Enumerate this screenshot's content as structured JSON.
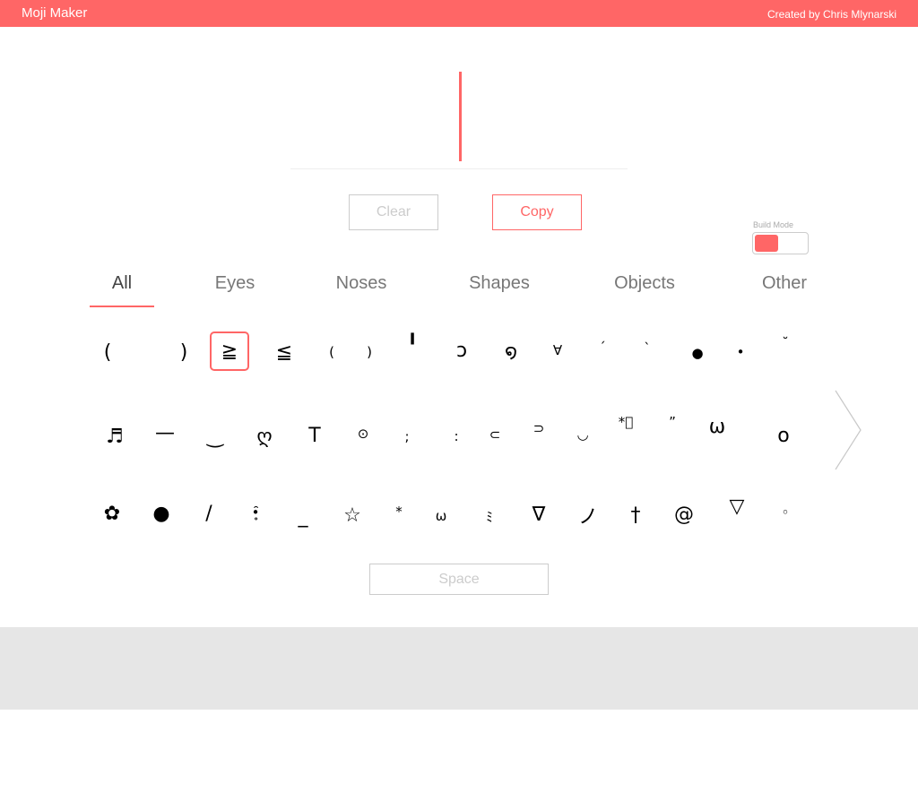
{
  "header": {
    "app_title": "Moji Maker",
    "credit": "Created by Chris Mlynarski"
  },
  "output": {
    "value": ""
  },
  "actions": {
    "clear_label": "Clear",
    "copy_label": "Copy"
  },
  "build_mode": {
    "label": "Build Mode",
    "enabled": false
  },
  "tabs": [
    {
      "label": "All",
      "active": true
    },
    {
      "label": "Eyes",
      "active": false
    },
    {
      "label": "Noses",
      "active": false
    },
    {
      "label": "Shapes",
      "active": false
    },
    {
      "label": "Objects",
      "active": false
    },
    {
      "label": "Other",
      "active": false
    }
  ],
  "symbols": {
    "row1": [
      "(",
      ")",
      "≧",
      "≦",
      "(",
      ")",
      "╹",
      "ɔ",
      "໑",
      "∀",
      "´",
      "`",
      "●",
      "•",
      "˘"
    ],
    "row2": [
      "♬",
      "—",
      "‿",
      "ღ",
      "T",
      "⊙",
      ";",
      ":",
      "⊂",
      "⊃",
      "◡",
      "*ﾟ",
      "”",
      "ω",
      "o"
    ],
    "row3": [
      "✿",
      "●",
      "/",
      "•̥̑",
      "_",
      "☆",
      "*",
      "ω",
      "ﾐ",
      "∇",
      "ノ",
      "†",
      "@",
      "▽",
      "◦"
    ],
    "selected": "≧"
  },
  "space_label": "Space",
  "colors": {
    "accent": "#ff6666",
    "border": "#cccccc",
    "muted_text": "#aaaaaa",
    "footer": "#e6e6e6"
  }
}
